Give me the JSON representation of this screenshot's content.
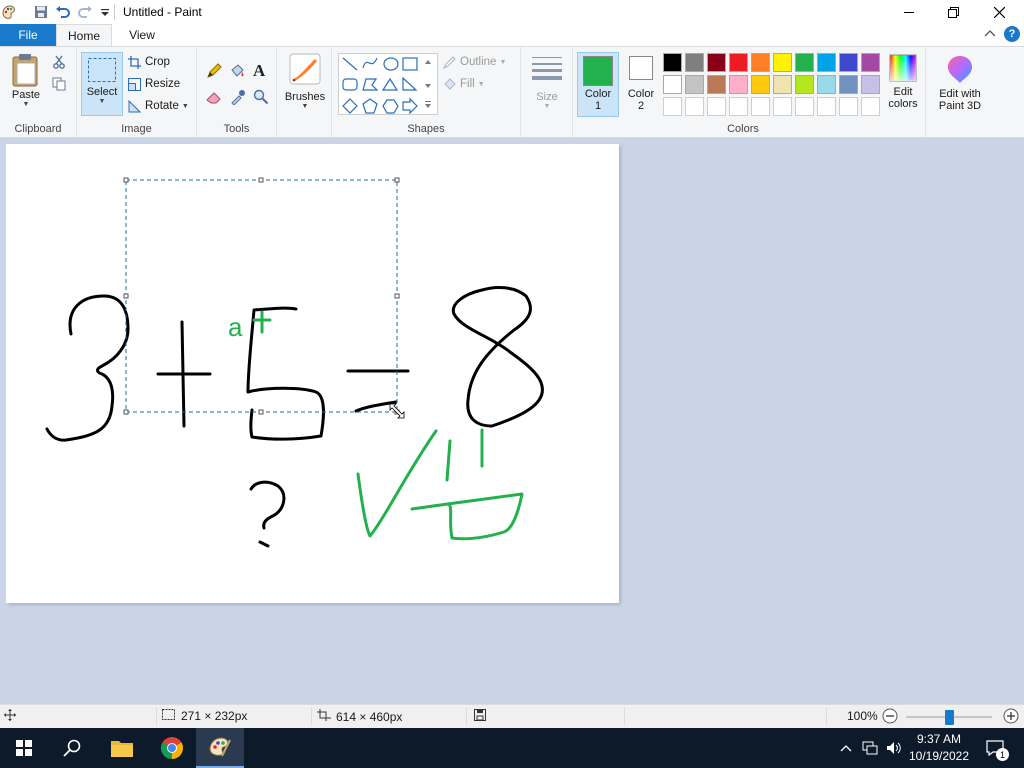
{
  "window": {
    "title": "Untitled - Paint"
  },
  "tabs": {
    "file": "File",
    "home": "Home",
    "view": "View"
  },
  "ribbon": {
    "clipboard": {
      "group_label": "Clipboard",
      "paste": "Paste"
    },
    "image": {
      "group_label": "Image",
      "select": "Select",
      "crop": "Crop",
      "resize": "Resize",
      "rotate": "Rotate"
    },
    "tools": {
      "group_label": "Tools"
    },
    "brushes": {
      "label": "Brushes"
    },
    "shapes": {
      "group_label": "Shapes",
      "outline": "Outline",
      "fill": "Fill"
    },
    "size": {
      "label": "Size"
    },
    "colors": {
      "group_label": "Colors",
      "color1_label": "Color",
      "color1_num": "1",
      "color2_label": "Color",
      "color2_num": "2",
      "edit_colors_line1": "Edit",
      "edit_colors_line2": "colors",
      "paint3d_line1": "Edit with",
      "paint3d_line2": "Paint 3D",
      "color1_value": "#22b14c",
      "color2_value": "#ffffff",
      "palette_row1": [
        "#000000",
        "#7f7f7f",
        "#880015",
        "#ed1c24",
        "#ff7f27",
        "#fff200",
        "#22b14c",
        "#00a2e8",
        "#3f48cc",
        "#a349a4"
      ],
      "palette_row2": [
        "#ffffff",
        "#c3c3c3",
        "#b97a57",
        "#ffaec9",
        "#ffc90e",
        "#efe4b0",
        "#b5e61d",
        "#99d9ea",
        "#7092be",
        "#c8bfe7"
      ]
    }
  },
  "canvas": {
    "stroke_black": "#000000",
    "stroke_green": "#22b14c"
  },
  "status": {
    "selection_size": "271 × 232px",
    "image_size": "614 × 460px",
    "zoom": "100%",
    "zoom_fraction": 0.5
  },
  "taskbar": {
    "time": "9:37 AM",
    "date": "10/19/2022",
    "notification_count": "1"
  }
}
